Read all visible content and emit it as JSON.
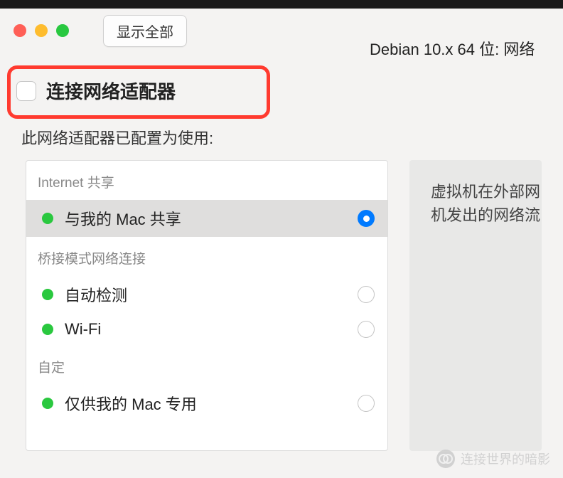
{
  "titlebar": {
    "show_all_label": "显示全部",
    "window_title": "Debian 10.x 64 位: 网络"
  },
  "main": {
    "connect_adapter_label": "连接网络适配器",
    "subtitle": "此网络适配器已配置为使用:"
  },
  "sections": {
    "internet_sharing": {
      "header": "Internet 共享",
      "items": [
        {
          "label": "与我的 Mac 共享",
          "selected": true
        }
      ]
    },
    "bridged": {
      "header": "桥接模式网络连接",
      "items": [
        {
          "label": "自动检测",
          "selected": false
        },
        {
          "label": "Wi-Fi",
          "selected": false
        }
      ]
    },
    "custom": {
      "header": "自定",
      "items": [
        {
          "label": "仅供我的 Mac 专用",
          "selected": false
        }
      ]
    }
  },
  "side_panel": {
    "line1": "虚拟机在外部网",
    "line2": "机发出的网络流"
  },
  "watermark": {
    "text": "连接世界的暗影"
  }
}
